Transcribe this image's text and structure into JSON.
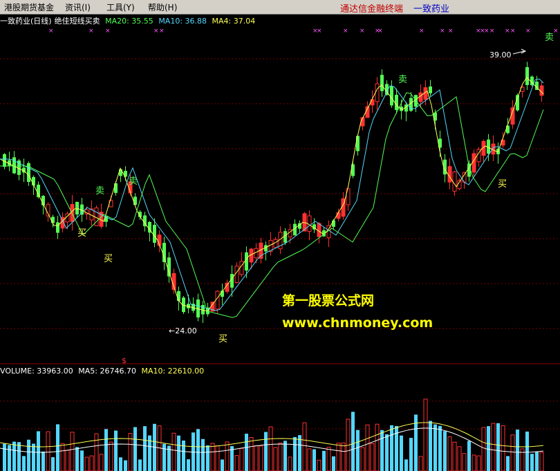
{
  "menu": {
    "items": [
      "港股期货基金",
      "资讯(I)",
      "工具(Y)",
      "帮助(H)"
    ],
    "link_terminal": "通达信金融终端",
    "link_stock": "一致药业"
  },
  "info": {
    "stock_title": "一致药业(日线)",
    "indicator_name": "绝佳短线买卖",
    "ma20": "MA20: 35.55",
    "ma10": "MA10: 36.88",
    "ma4": "MA4: 37.04"
  },
  "chart": {
    "high_label": "39.00",
    "low_label": "←24.00",
    "buy_label": "买",
    "sell_label": "卖",
    "dollar_label": "$"
  },
  "volume": {
    "volume": "VOLUME: 33963.00",
    "ma5": "MA5: 26746.70",
    "ma10": "MA10: 22610.00"
  },
  "watermark": {
    "site_name": "第一股票公式网",
    "site_url": "www.chnmoney.com"
  },
  "colors": {
    "up": "#ff3232",
    "down": "#54fc54",
    "ma20": "#54fc54",
    "ma10": "#54d6fc",
    "ma4": "#ffff54",
    "grid": "#8b0000",
    "marker": "#ff54ff",
    "watermark": "#ffff00",
    "menu_red": "#c00000",
    "menu_blue": "#0000c0"
  },
  "chart_data": {
    "type": "candlestick",
    "title": "一致药业(日线)",
    "indicator": "绝佳短线买卖",
    "series_ma": [
      {
        "name": "MA20",
        "last": 35.55
      },
      {
        "name": "MA10",
        "last": 36.88
      },
      {
        "name": "MA4",
        "last": 37.04
      }
    ],
    "price_high": 39.0,
    "price_low": 24.0,
    "volume_last": 33963.0,
    "volume_ma5": 26746.7,
    "volume_ma10": 22610.0,
    "signals": {
      "buy": [
        "买",
        "买",
        "买",
        "买"
      ],
      "sell": [
        "卖",
        "卖",
        "卖",
        "卖"
      ]
    }
  }
}
